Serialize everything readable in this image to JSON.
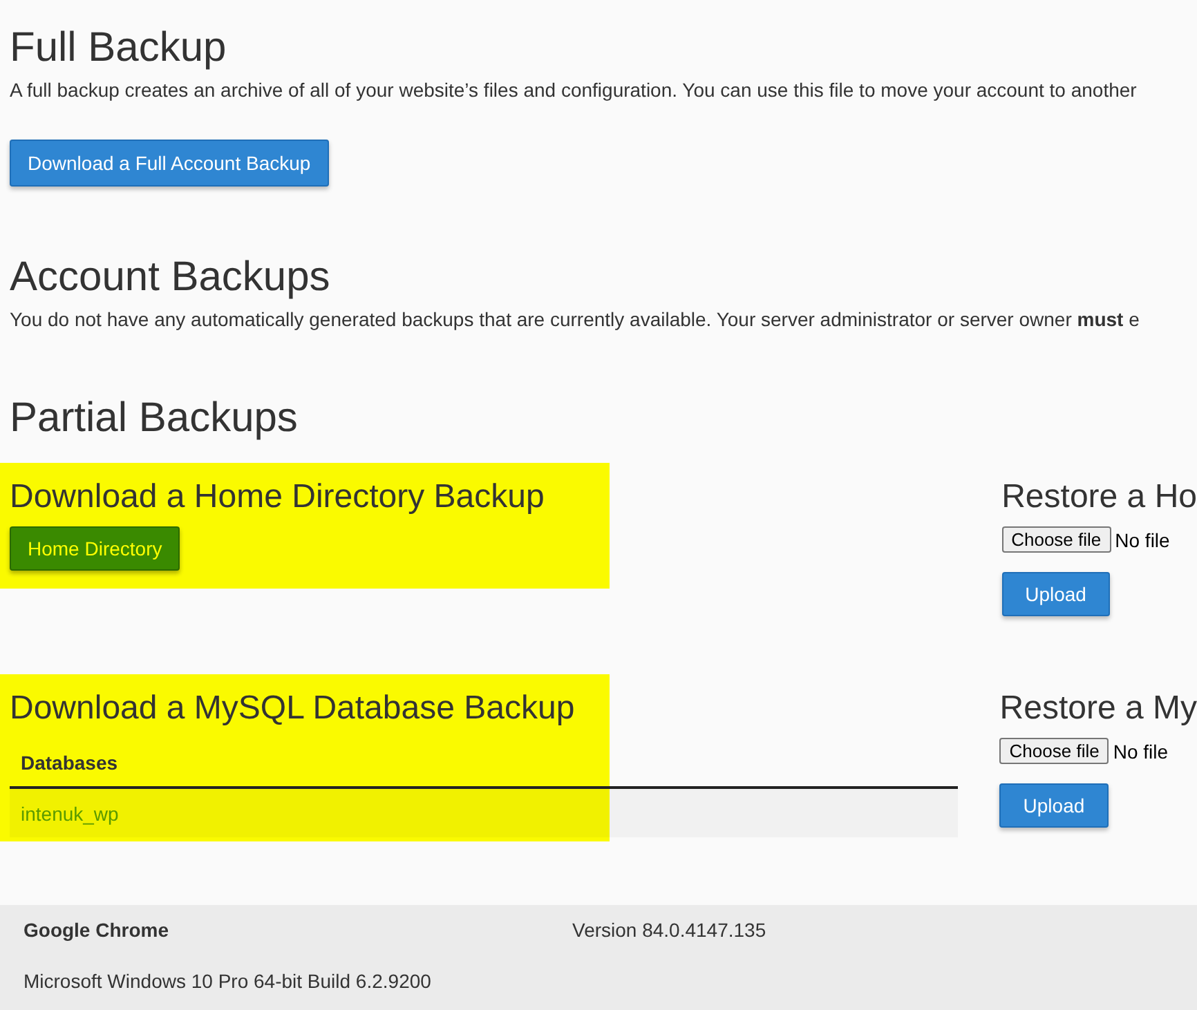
{
  "full_backup": {
    "title": "Full Backup",
    "description": "A full backup creates an archive of all of your website’s files and configuration. You can use this file to move your account to another",
    "button": "Download a Full Account Backup"
  },
  "account_backups": {
    "title": "Account Backups",
    "description": "You do not have any automatically generated backups that are currently available. Your server administrator or server owner **must** e"
  },
  "partial_backups": {
    "title": "Partial Backups",
    "sections": [
      {
        "kind": "button",
        "highlighted": true,
        "title": "Download a Home Directory Backup",
        "button": "Home Directory",
        "restore": {
          "title": "Restore a Ho",
          "choose": "Choose file",
          "status": "No file",
          "upload": "Upload"
        }
      },
      {
        "kind": "table",
        "highlighted": true,
        "title": "Download a MySQL Database Backup",
        "column": "Databases",
        "rows": [
          "intenuk_wp"
        ],
        "restore": {
          "title": "Restore a My",
          "choose": "Choose file",
          "status": "No file",
          "upload": "Upload"
        }
      }
    ]
  },
  "footer": {
    "browser": "Google Chrome",
    "version": "Version 84.0.4147.135",
    "os": "Microsoft Windows 10 Pro 64-bit Build 6.2.9200"
  }
}
